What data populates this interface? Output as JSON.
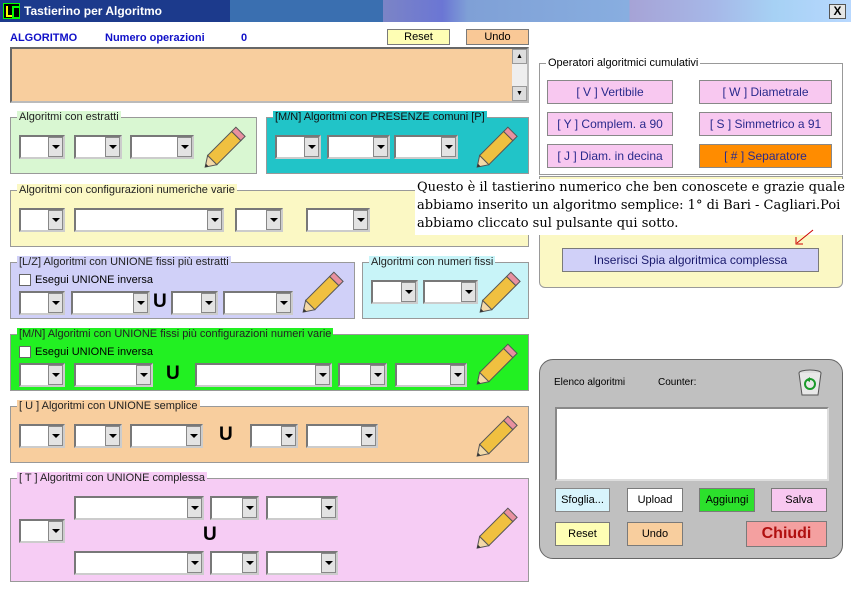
{
  "window": {
    "title": "Tastierino per Algoritmo",
    "close": "X"
  },
  "header": {
    "algoritmo": "ALGORITMO",
    "num_ops_label": "Numero operazioni",
    "num_ops": "0",
    "reset": "Reset",
    "undo": "Undo"
  },
  "panels": {
    "estratti": "Algoritmi con estratti",
    "presenze": "[M/N] Algoritmi con PRESENZE comuni [P]",
    "configurazioni": "Algoritmi con configurazioni numeriche varie",
    "unione_fissi_estratti": "[L/Z] Algoritmi con UNIONE fissi più estratti",
    "numeri_fissi": "Algoritmi con numeri fissi",
    "unione_fissi_config": "[M/N] Algoritmi con UNIONE fissi più configurazioni numeri varie",
    "unione_semplice": "[ U ] Algoritmi con UNIONE semplice",
    "unione_complessa": "[ T ] Algoritmi con UNIONE complessa"
  },
  "checkbox_label": "Esegui UNIONE inversa",
  "union_symbol": "U",
  "operatori": {
    "title": "Operatori algoritmici cumulativi",
    "buttons": [
      "[ V ] Vertibile",
      "[ W ] Diametrale",
      "[ Y ] Complem. a 90",
      "[ S ] Simmetrico  a 91",
      "[ J ] Diam. in decina",
      "[ # ] Separatore"
    ]
  },
  "tooltip": "Questo è il tastierino numerico che ben conoscete e grazie quale abbiamo inserito un algoritmo semplice: 1° di Bari - Cagliari.Poi abbiamo cliccato sul pulsante qui sotto.",
  "spia_button": "Inserisci Spia algoritmica complessa",
  "elenco": {
    "title": "Elenco algoritmi",
    "counter": "Counter:",
    "sfoglia": "Sfoglia...",
    "upload": "Upload",
    "aggiungi": "Aggiungi",
    "salva": "Salva",
    "reset": "Reset",
    "undo": "Undo",
    "chiudi": "Chiudi"
  },
  "colors": {
    "green_panel": "#d9f7d2",
    "cyan_panel": "#21c4c8",
    "yellow_panel": "#fbf8c4",
    "lavender_panel": "#d0d0f8",
    "lightcyan_panel": "#c8f4f8",
    "green2_panel": "#22f022",
    "peach_panel": "#f8ce9e",
    "pink_panel": "#f6ccf4",
    "separator": "#ff8c00",
    "chiudi": "#f4a0a0"
  }
}
